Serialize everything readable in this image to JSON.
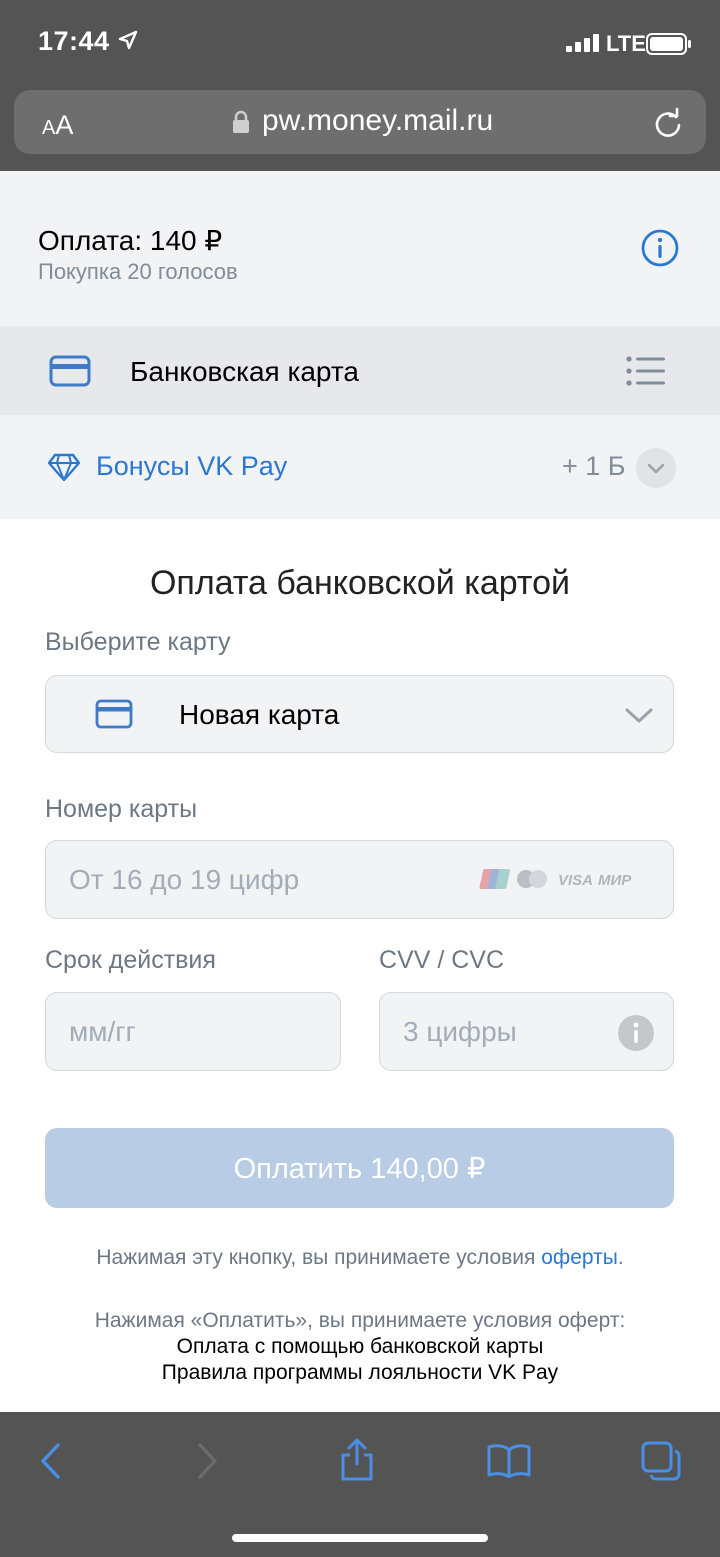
{
  "status_bar": {
    "time": "17:44",
    "network": "LTE"
  },
  "browser": {
    "aa_small": "A",
    "aa_big": "A",
    "url": "pw.money.mail.ru"
  },
  "payment": {
    "title": "Оплата: 140 ₽",
    "subtitle": "Покупка 20 голосов"
  },
  "method": {
    "label": "Банковская карта"
  },
  "bonus": {
    "label": "Бонусы VK Pay",
    "value": "+ 1 Б"
  },
  "form": {
    "heading": "Оплата банковской картой",
    "select_card_label": "Выберите карту",
    "select_card_value": "Новая карта",
    "card_number_label": "Номер карты",
    "card_number_placeholder": "От 16 до 19 цифр",
    "expiry_label": "Срок действия",
    "expiry_placeholder": "мм/гг",
    "cvv_label": "CVV / CVC",
    "cvv_placeholder": "3 цифры",
    "brands": {
      "visa": "VISA",
      "mir": "МИР"
    },
    "pay_button": "Оплатить 140,00 ₽"
  },
  "terms": {
    "line1_prefix": "Нажимая эту кнопку, вы принимаете условия ",
    "line1_link": "оферты",
    "line1_suffix": ".",
    "line2": "Нажимая «Оплатить», вы принимаете условия оферт:",
    "link_card": "Оплата с помощью банковской карты",
    "link_loyalty": "Правила программы лояльности VK Pay"
  },
  "colors": {
    "accent": "#2a78d2",
    "pay_button_disabled": "#b8cce6",
    "browser_chrome": "#545454"
  }
}
